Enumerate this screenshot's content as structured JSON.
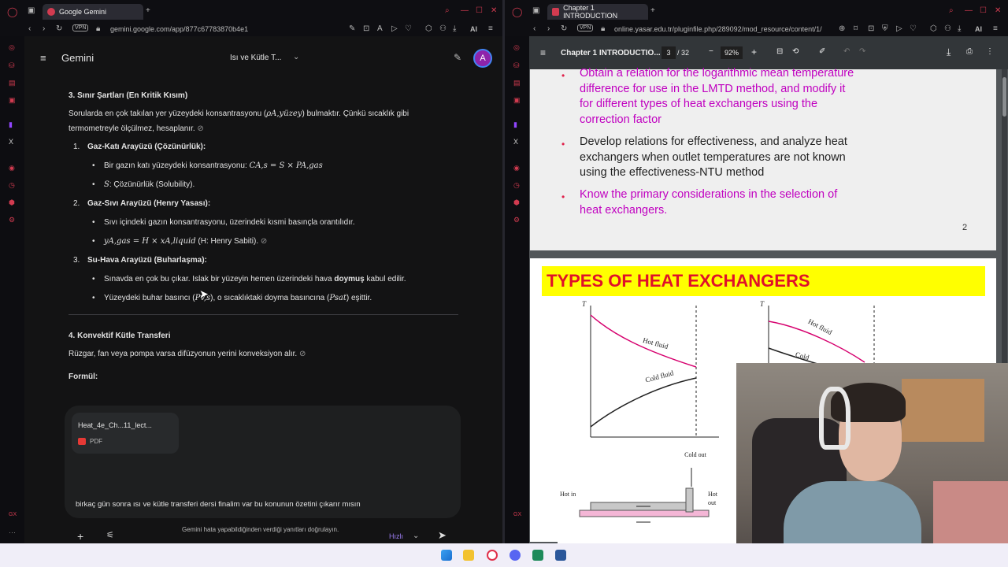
{
  "left_window": {
    "tab_title": "Google Gemini",
    "url": "gemini.google.com/app/877c67783870b4e1",
    "vpn": "VPN",
    "ai": "AI",
    "app_name": "Gemini",
    "chat_title": "Isı ve Kütle T...",
    "avatar": "A",
    "content": {
      "section3_title": "3. Sınır Şartları (En Kritik Kısım)",
      "section3_intro_a": "Sorularda en çok takılan yer yüzeydeki konsantrasyonu (",
      "section3_intro_math": "ρA,yüzey",
      "section3_intro_b": ") bulmaktır. Çünkü sıcaklık gibi",
      "section3_intro_line2": "termometreyle ölçülmez, hesaplanır.",
      "item1_title": "Gaz-Katı Arayüzü (Çözünürlük):",
      "item1_b1_a": "Bir gazın katı yüzeydeki konsantrasyonu:",
      "item1_b1_math": "CA,s = S × PA,gas",
      "item1_b2_math": "S",
      "item1_b2": ": Çözünürlük (Solubility).",
      "item2_title": "Gaz-Sıvı Arayüzü (Henry Yasası):",
      "item2_b1": "Sıvı içindeki gazın konsantrasyonu, üzerindeki kısmi basınçla orantılıdır.",
      "item2_b2_math": "yA,gas = H × xA,liquid",
      "item2_b2": "(H: Henry Sabiti).",
      "item3_title": "Su-Hava Arayüzü (Buharlaşma):",
      "item3_b1_a": "Sınavda en çok bu çıkar. Islak bir yüzeyin hemen üzerindeki hava",
      "item3_b1_bold": "doymuş",
      "item3_b1_b": "kabul edilir.",
      "item3_b2_a": "Yüzeydeki buhar basıncı (",
      "item3_b2_math1": "Pv,s",
      "item3_b2_b": "), o sıcaklıktaki doyma basıncına (",
      "item3_b2_math2": "Psat",
      "item3_b2_c": ") eşittir.",
      "section4_title": "4. Konvektif Kütle Transferi",
      "section4_text": "Rüzgar, fan veya pompa varsa difüzyonun yerini konveksiyon alır.",
      "formula_label": "Formül:"
    },
    "attachment": {
      "name": "Heat_4e_Ch...11_lect...",
      "type": "PDF"
    },
    "prompt_text": "birkaç gün sonra ısı ve kütle transferi dersi finalim var bu konunun özetini çıkarır mısın",
    "model_label": "Hızlı",
    "disclaimer": "Gemini hata yapabildiğinden verdiği yanıtları doğrulayın.",
    "accent": "#9b7cf0"
  },
  "right_window": {
    "tab_title": "Chapter 1 INTRODUCTION",
    "url": "online.yasar.edu.tr/pluginfile.php/289092/mod_resource/content/1/",
    "vpn": "VPN",
    "ai": "AI",
    "pdf_title": "Chapter 1 INTRODUCTIO...",
    "page_current": "3",
    "page_total": "/ 32",
    "zoom": "92%",
    "page1": {
      "obj1": [
        "Obtain a relation for the logarithmic mean temperature",
        "difference for use in the LMTD method, and modify it",
        "for different types of heat exchangers using the",
        "correction factor"
      ],
      "obj2": [
        "Develop relations for effectiveness, and analyze heat",
        "exchangers when outlet temperatures are not known",
        "using the effectiveness-NTU method"
      ],
      "obj3": [
        "Know the primary considerations in the selection of",
        "heat exchangers."
      ],
      "page_number": "2"
    },
    "page2": {
      "heading": "TYPES OF HEAT EXCHANGERS",
      "axis_t": "T",
      "axis_t2": "T",
      "hot_fluid": "Hot fluid",
      "cold_fluid": "Cold fluid",
      "hot_fluid2": "Hot fluid",
      "cold_fluid2": "Cold",
      "cold_out": "Cold out",
      "hot_in": "Hot in",
      "hot_out": "Hot out"
    }
  },
  "colors": {
    "pink": "#c000c0",
    "heading_bg": "#ffff00",
    "heading_fg": "#e0102a",
    "opera_red": "#d23b50"
  }
}
